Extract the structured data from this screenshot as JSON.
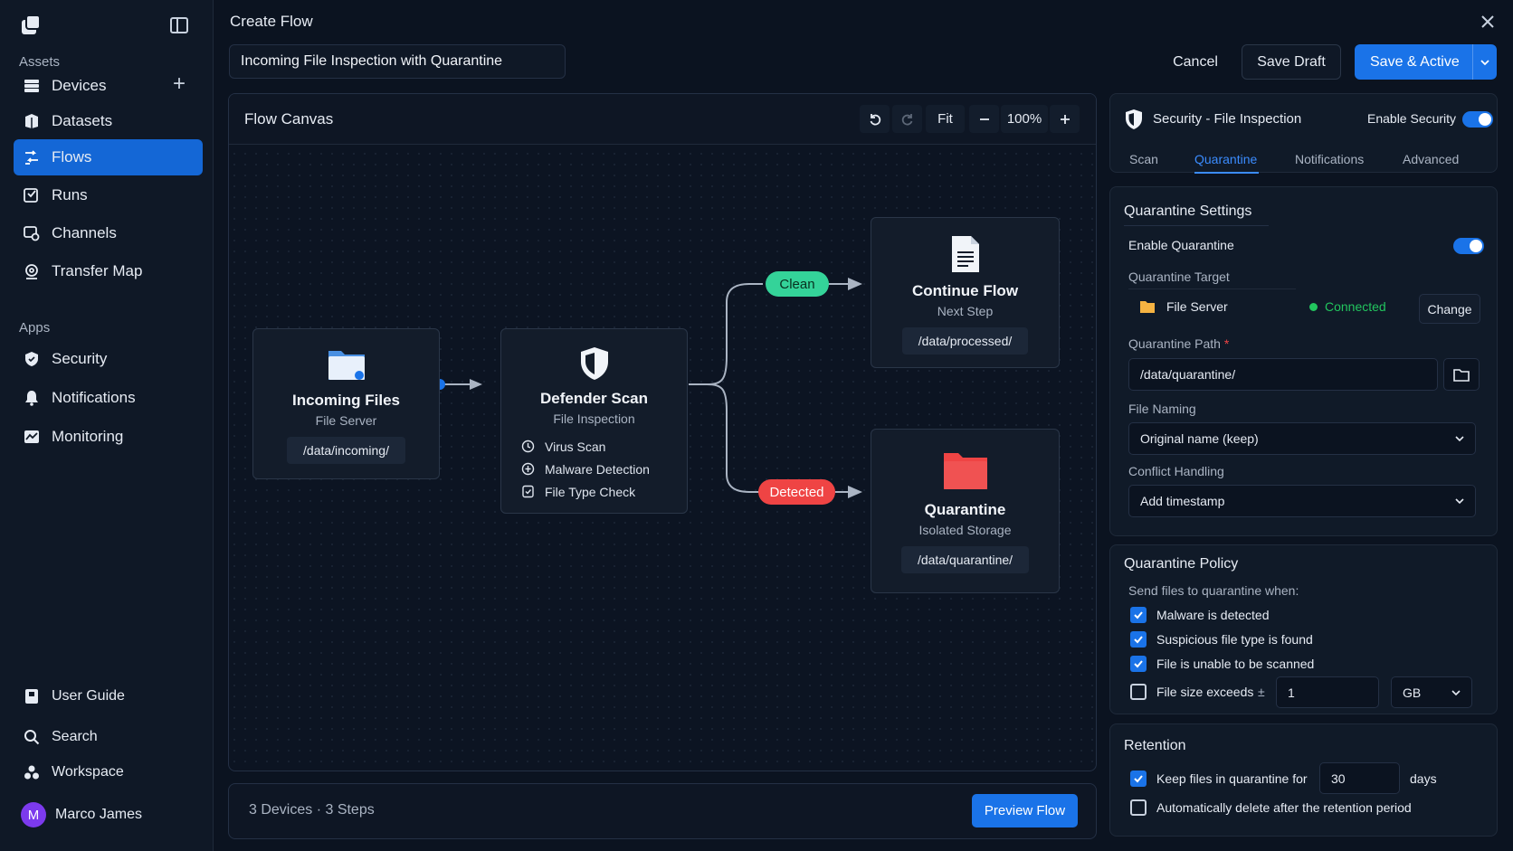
{
  "sidebar": {
    "assets_label": "Assets",
    "apps_label": "Apps",
    "items": [
      {
        "label": "Devices"
      },
      {
        "label": "Datasets"
      },
      {
        "label": "Flows"
      },
      {
        "label": "Runs"
      },
      {
        "label": "Channels"
      },
      {
        "label": "Transfer Map"
      }
    ],
    "apps": [
      {
        "label": "Security"
      },
      {
        "label": "Notifications"
      },
      {
        "label": "Monitoring"
      }
    ],
    "bottom": [
      {
        "label": "User Guide"
      },
      {
        "label": "Search"
      },
      {
        "label": "Workspace"
      }
    ],
    "user": {
      "initial": "M",
      "name": "Marco James"
    }
  },
  "header": {
    "title": "Create Flow",
    "flow_name": "Incoming File Inspection with Quarantine",
    "cancel": "Cancel",
    "save_draft": "Save Draft",
    "save_active": "Save & Active"
  },
  "canvas": {
    "title": "Flow Canvas",
    "fit": "Fit",
    "zoom": "100%",
    "nodes": {
      "incoming": {
        "title": "Incoming Files",
        "subtitle": "File Server",
        "path": "/data/incoming/"
      },
      "defender": {
        "title": "Defender Scan",
        "subtitle": "File Inspection",
        "features": [
          "Virus Scan",
          "Malware Detection",
          "File Type Check"
        ]
      },
      "continue": {
        "title": "Continue Flow",
        "subtitle": "Next Step",
        "path": "/data/processed/"
      },
      "quarantine": {
        "title": "Quarantine",
        "subtitle": "Isolated Storage",
        "path": "/data/quarantine/"
      }
    },
    "edges": {
      "clean": "Clean",
      "detected": "Detected"
    },
    "footer": {
      "stats": "3 Devices · 3 Steps",
      "preview": "Preview Flow"
    }
  },
  "panel": {
    "title": "Security - File Inspection",
    "enable_security": "Enable Security",
    "tabs": [
      "Scan",
      "Quarantine",
      "Notifications",
      "Advanced"
    ],
    "active_tab": "Quarantine",
    "settings": {
      "title": "Quarantine Settings",
      "enable_quarantine": "Enable Quarantine",
      "target_label": "Quarantine Target",
      "target_name": "File Server",
      "target_status": "Connected",
      "change": "Change",
      "path_label": "Quarantine Path",
      "path_value": "/data/quarantine/",
      "naming_label": "File Naming",
      "naming_value": "Original name (keep)",
      "conflict_label": "Conflict Handling",
      "conflict_value": "Add timestamp"
    },
    "policy": {
      "title": "Quarantine Policy",
      "subtitle": "Send files to quarantine when:",
      "rules": [
        {
          "label": "Malware is detected",
          "checked": true
        },
        {
          "label": "Suspicious file type is found",
          "checked": true
        },
        {
          "label": "File is unable to be scanned",
          "checked": true
        },
        {
          "label": "File size exceeds",
          "checked": false
        }
      ],
      "size_value": "1",
      "size_unit": "GB"
    },
    "retention": {
      "title": "Retention",
      "keep_label": "Keep files in quarantine for",
      "keep_value": "30",
      "keep_unit": "days",
      "auto_delete": "Automatically delete after the retention period"
    }
  },
  "colors": {
    "accent": "#1a73e8",
    "clean": "#34d399",
    "detected": "#ef4444",
    "connected": "#22c55e",
    "folder": "#f5b342"
  }
}
